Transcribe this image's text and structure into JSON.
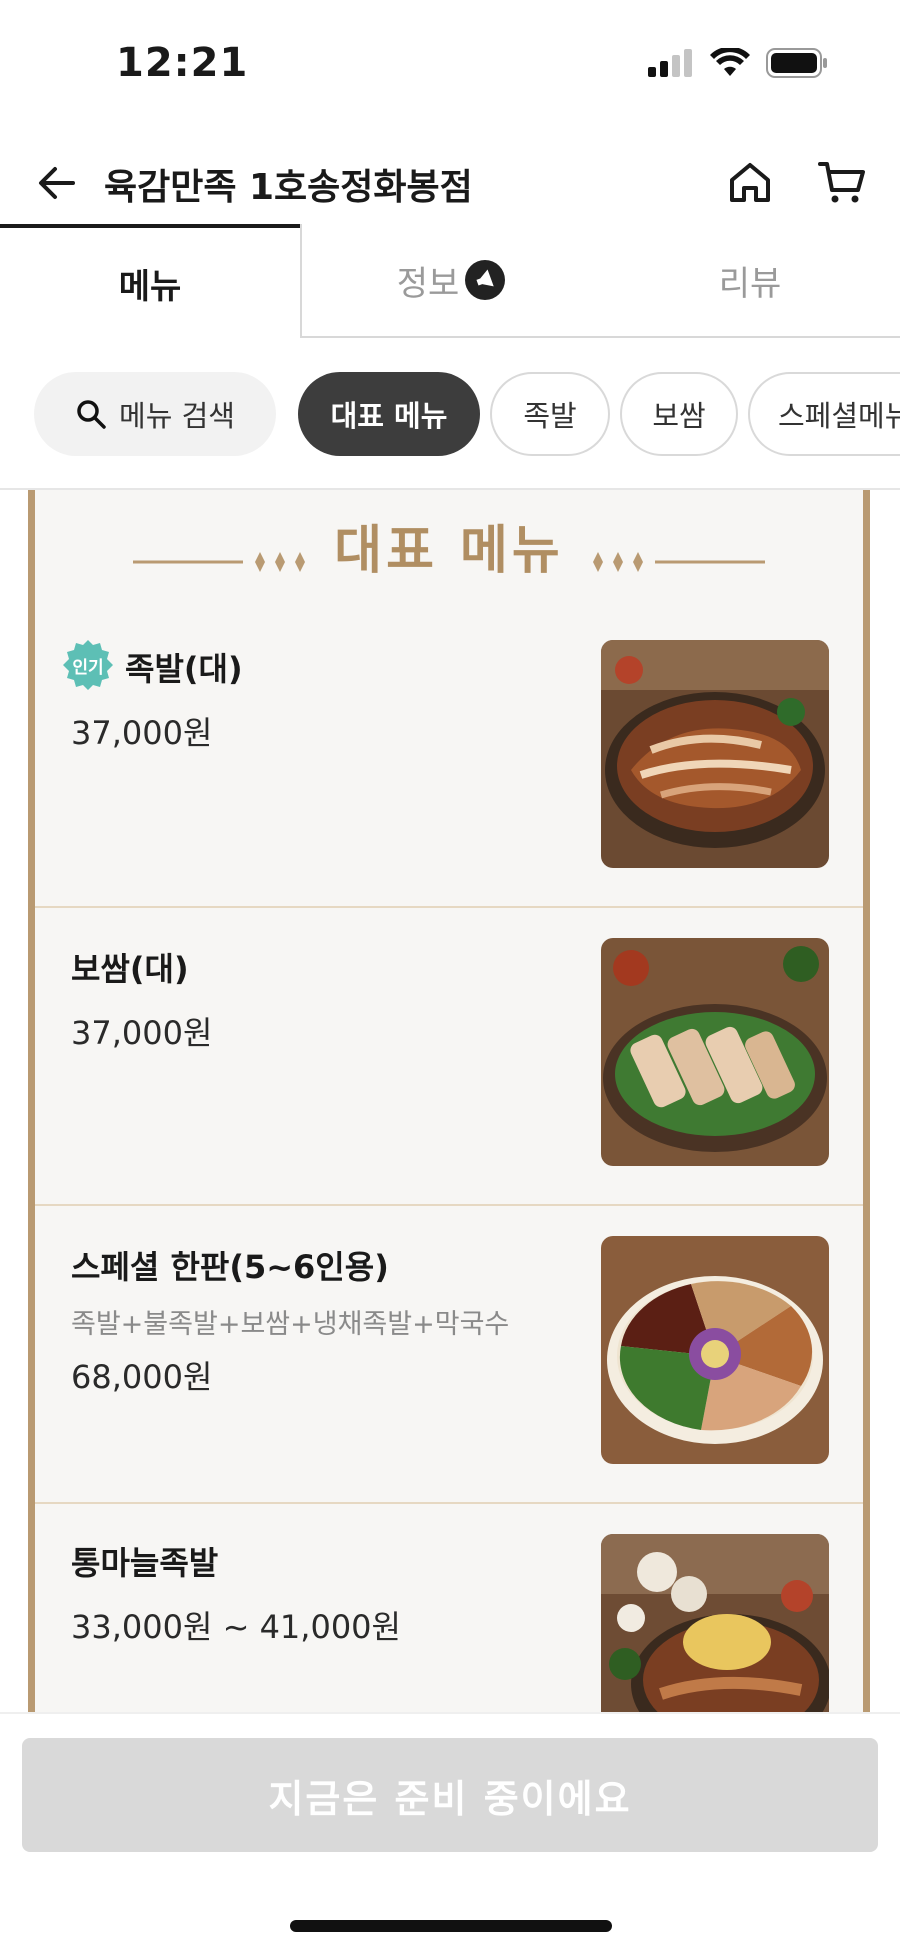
{
  "status_bar": {
    "time": "12:21"
  },
  "header": {
    "title": "육감만족 1호송정화봉점",
    "back_icon": "arrow-left-icon",
    "home_icon": "home-icon",
    "cart_icon": "cart-icon"
  },
  "tabs": [
    {
      "label": "메뉴",
      "active": true
    },
    {
      "label": "정보",
      "active": false,
      "icon": "megaphone-icon"
    },
    {
      "label": "리뷰",
      "active": false
    }
  ],
  "chips": {
    "search_label": "메뉴 검색",
    "items": [
      {
        "label": "대표 메뉴",
        "active": true
      },
      {
        "label": "족발",
        "active": false
      },
      {
        "label": "보쌈",
        "active": false
      },
      {
        "label": "스페셜메뉴",
        "active": false
      }
    ]
  },
  "section": {
    "title": "대표 메뉴"
  },
  "menu_items": [
    {
      "badge": "인기",
      "name": "족발(대)",
      "description": "",
      "price": "37,000원"
    },
    {
      "badge": "",
      "name": "보쌈(대)",
      "description": "",
      "price": "37,000원"
    },
    {
      "badge": "",
      "name": "스페셜 한판(5~6인용)",
      "description": "족발+불족발+보쌈+냉채족발+막국수",
      "price": "68,000원"
    },
    {
      "badge": "",
      "name": "통마늘족발",
      "description": "",
      "price": "33,000원 ~ 41,000원"
    }
  ],
  "bottom": {
    "button_label": "지금은 준비 중이에요"
  },
  "colors": {
    "accent_gold": "#b08e62",
    "popular_badge": "#5dbfb5",
    "active_chip": "#3d3d3d",
    "disabled_button": "#d9d9d9"
  }
}
